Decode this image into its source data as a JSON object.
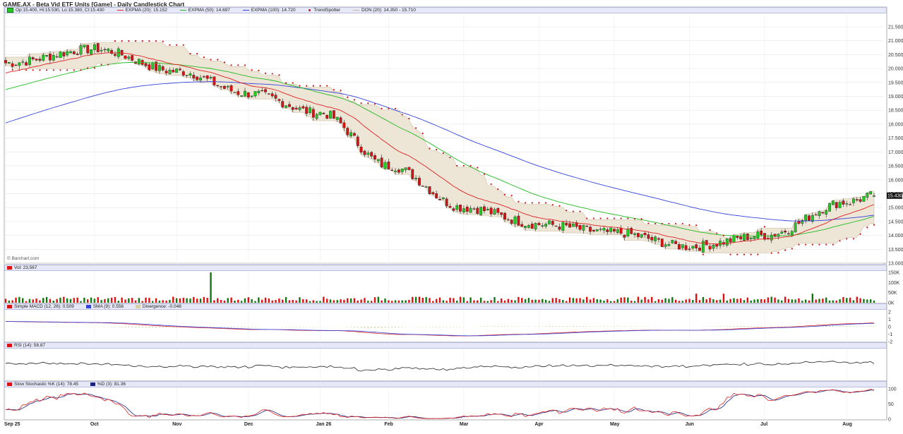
{
  "title": "GAME.AX - Beta Vid ETF Units [Game] - Daily Candlestick Chart",
  "credit": "© Barchart.com",
  "price_legend": {
    "ohlc": "Op:15.400, Hi:15.530, Lo:15.380, Cl:15.430",
    "ema20": "EXPMA (20): 15.152",
    "ema50": "EXPMA (50): 14.697",
    "ema100": "EXPMA (100): 14.720",
    "trendspotter": "TrendSpotter",
    "donchian": "DON (20): 14.350 - 15.710"
  },
  "volume_legend": {
    "vol": "Vol: 23,567"
  },
  "macd_legend": {
    "macd": "Simple MACD (12, 26): 0.509",
    "sma": "SMA (9): 0.556",
    "div": "Divergence: -0.048"
  },
  "rsi_legend": {
    "rsi": "RSI (14): 58.87"
  },
  "stoch_legend": {
    "k": "Slow Stochastic %K (14): 78.45",
    "d": "%D (3): 81.36"
  },
  "last_price_label": "15.430",
  "colors": {
    "up": "#22cc22",
    "down": "#dd1111",
    "ema20": "#dd2222",
    "ema50": "#22bb22",
    "ema100": "#3344dd",
    "donchian": "#ece3d2",
    "trend": "#cc1111",
    "legendbar": "#e6e8f7"
  },
  "chart_data": [
    {
      "type": "candlestick",
      "title": "GAME.AX - Beta Vid ETF Units [Game] - Daily Candlestick Chart",
      "x_labels": [
        "Sep 25",
        "Oct",
        "Nov",
        "Dec",
        "Jan 26",
        "Feb",
        "Mar",
        "Apr",
        "May",
        "Jun",
        "Jul",
        "Aug"
      ],
      "y_ticks": [
        "21.500",
        "21.000",
        "20.500",
        "20.000",
        "19.500",
        "19.000",
        "18.500",
        "18.000",
        "17.500",
        "17.000",
        "16.500",
        "16.000",
        "15.500",
        "15.000",
        "14.500",
        "14.000",
        "13.500",
        "13.000"
      ],
      "ylim": [
        13.0,
        21.5
      ],
      "close_points": [
        {
          "x": "Sep 25",
          "y": 20.2
        },
        {
          "x": "Oct",
          "y": 20.7
        },
        {
          "x": "Nov",
          "y": 19.9
        },
        {
          "x": "Dec",
          "y": 19.1
        },
        {
          "x": "Jan 26",
          "y": 18.4
        },
        {
          "x": "Feb",
          "y": 16.5
        },
        {
          "x": "Mar",
          "y": 15.0
        },
        {
          "x": "Apr",
          "y": 14.4
        },
        {
          "x": "May",
          "y": 14.1
        },
        {
          "x": "Jun",
          "y": 13.6
        },
        {
          "x": "Jul",
          "y": 14.0
        },
        {
          "x": "Aug",
          "y": 15.2
        },
        {
          "x": "last",
          "y": 15.43
        }
      ],
      "ema100_points": [
        {
          "x": "Sep 25",
          "y": 18.1
        },
        {
          "x": "Nov",
          "y": 19.6
        },
        {
          "x": "Jan 26",
          "y": 19.0
        },
        {
          "x": "Mar",
          "y": 17.3
        },
        {
          "x": "May",
          "y": 15.7
        },
        {
          "x": "Jul",
          "y": 14.85
        },
        {
          "x": "last",
          "y": 14.72
        }
      ],
      "last_values": {
        "open": 15.4,
        "high": 15.53,
        "low": 15.38,
        "close": 15.43,
        "ema20": 15.152,
        "ema50": 14.697,
        "ema100": 14.72,
        "don_low": 14.35,
        "don_high": 15.71
      }
    },
    {
      "type": "bar",
      "title": "Vol: 23,567",
      "y_ticks": [
        "150K",
        "100K",
        "50K",
        "0K"
      ],
      "last_value": 23567
    },
    {
      "type": "line",
      "title": "Simple MACD (12, 26)",
      "y_ticks": [
        "2",
        "1",
        "0",
        "-1",
        "-2"
      ],
      "last_values": {
        "macd": 0.509,
        "sma": 0.556,
        "divergence": -0.048
      }
    },
    {
      "type": "line",
      "title": "RSI (14)",
      "last_value": 58.87
    },
    {
      "type": "line",
      "title": "Slow Stochastic",
      "y_ticks": [
        "100",
        "50",
        "0"
      ],
      "last_values": {
        "k": 78.45,
        "d": 81.36
      }
    }
  ]
}
